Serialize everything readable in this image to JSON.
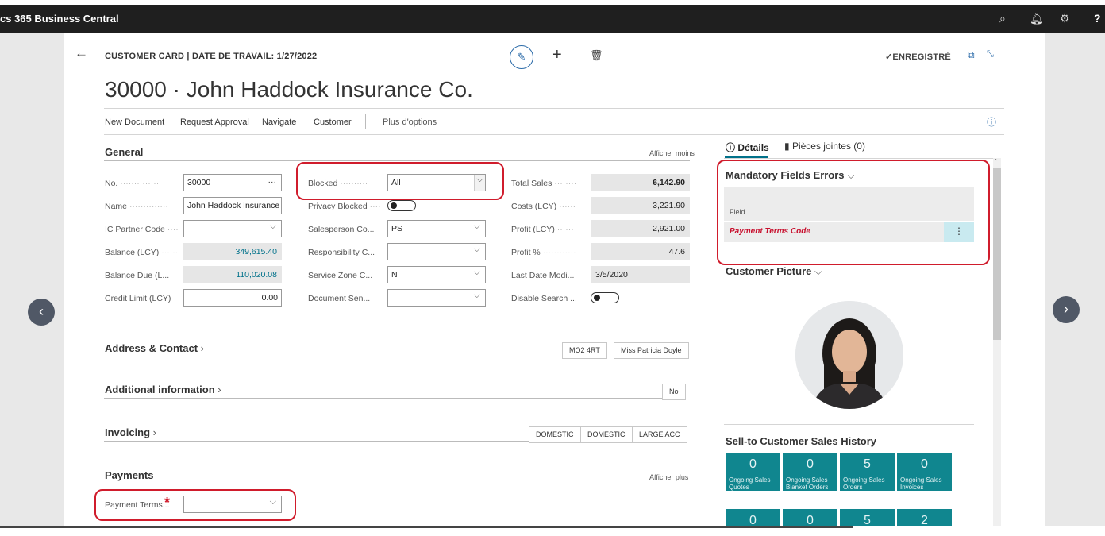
{
  "app": {
    "title": "cs 365 Business Central"
  },
  "header": {
    "caption": "CUSTOMER CARD | DATE DE TRAVAIL: 1/27/2022",
    "title": "30000 · John Haddock Insurance Co.",
    "saved_label": "✓ENREGISTRÉ"
  },
  "actions": [
    "New Document",
    "Request Approval",
    "Navigate",
    "Customer",
    "Plus d'options"
  ],
  "general": {
    "title": "General",
    "toggle_label": "Afficher moins",
    "col1": [
      {
        "label": "No.",
        "value": "30000"
      },
      {
        "label": "Name",
        "value": "John Haddock Insurance"
      },
      {
        "label": "IC Partner Code",
        "value": ""
      },
      {
        "label": "Balance (LCY)",
        "value": "349,615.40"
      },
      {
        "label": "Balance Due (L...",
        "value": "110,020.08"
      },
      {
        "label": "Credit Limit (LCY)",
        "value": "0.00"
      }
    ],
    "col2": [
      {
        "label": "Blocked",
        "value": "All"
      },
      {
        "label": "Privacy Blocked",
        "value": ""
      },
      {
        "label": "Salesperson Co...",
        "value": "PS"
      },
      {
        "label": "Responsibility C...",
        "value": ""
      },
      {
        "label": "Service Zone C...",
        "value": "N"
      },
      {
        "label": "Document Sen...",
        "value": ""
      }
    ],
    "col3": [
      {
        "label": "Total Sales",
        "value": "6,142.90"
      },
      {
        "label": "Costs (LCY)",
        "value": "3,221.90"
      },
      {
        "label": "Profit (LCY)",
        "value": "2,921.00"
      },
      {
        "label": "Profit %",
        "value": "47.6"
      },
      {
        "label": "Last Date Modi...",
        "value": "3/5/2020"
      },
      {
        "label": "Disable Search ...",
        "value": ""
      }
    ]
  },
  "sections": {
    "address": {
      "title": "Address & Contact",
      "chips": [
        "MO2 4RT",
        "Miss Patricia Doyle"
      ]
    },
    "additional": {
      "title": "Additional information",
      "chips": [
        "No"
      ]
    },
    "invoicing": {
      "title": "Invoicing",
      "chips": [
        "DOMESTIC",
        "DOMESTIC",
        "LARGE ACC"
      ]
    },
    "payments": {
      "title": "Payments",
      "toggle_label": "Afficher plus",
      "field_label": "Payment Terms...",
      "required_mark": "*",
      "field_value": ""
    }
  },
  "factbox": {
    "tabs": [
      "Détails",
      "Pièces jointes (0)"
    ],
    "mandatory": {
      "title": "Mandatory Fields Errors",
      "column": "Field",
      "row": "Payment Terms Code"
    },
    "picture": {
      "title": "Customer Picture"
    },
    "history": {
      "title": "Sell-to Customer Sales History",
      "tiles": [
        {
          "value": "0",
          "label": "Ongoing Sales Quotes"
        },
        {
          "value": "0",
          "label": "Ongoing Sales Blanket Orders"
        },
        {
          "value": "5",
          "label": "Ongoing Sales Orders"
        },
        {
          "value": "0",
          "label": "Ongoing Sales Invoices"
        },
        {
          "value": "0",
          "label": ""
        },
        {
          "value": "0",
          "label": ""
        },
        {
          "value": "5",
          "label": ""
        },
        {
          "value": "2",
          "label": ""
        }
      ]
    }
  },
  "colors": {
    "accent": "#00718a",
    "tile": "#10868f",
    "highlight": "#d01c2c",
    "error_text": "#c8102e"
  },
  "icons": [
    "back-arrow-icon",
    "edit-icon",
    "plus-icon",
    "delete-icon",
    "open-new-window-icon",
    "collapse-icon",
    "info-icon",
    "search-icon",
    "bell-icon",
    "settings-icon",
    "help-icon",
    "chevron-left-icon",
    "chevron-right-icon"
  ]
}
